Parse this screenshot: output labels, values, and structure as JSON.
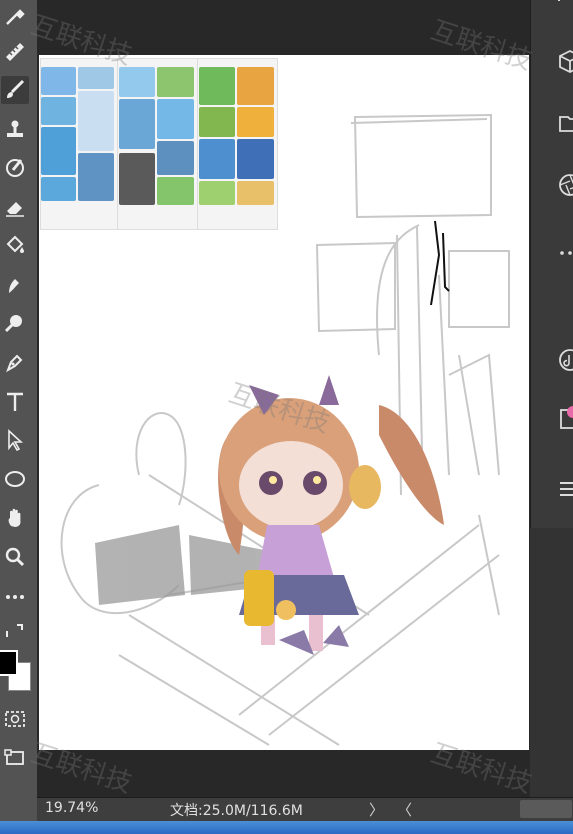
{
  "toolbar": {
    "tools": [
      {
        "name": "eyedropper-icon"
      },
      {
        "name": "ruler-icon"
      },
      {
        "name": "brush-icon"
      },
      {
        "name": "stamp-icon"
      },
      {
        "name": "history-brush-icon"
      },
      {
        "name": "eraser-icon"
      },
      {
        "name": "paint-bucket-icon"
      },
      {
        "name": "smudge-icon"
      },
      {
        "name": "dodge-icon"
      },
      {
        "name": "pen-icon"
      },
      {
        "name": "type-icon"
      },
      {
        "name": "path-select-icon"
      },
      {
        "name": "ellipse-icon"
      },
      {
        "name": "hand-icon"
      },
      {
        "name": "zoom-icon"
      },
      {
        "name": "more-tools-icon"
      }
    ],
    "foreground_color": "#000000",
    "background_color": "#ffffff"
  },
  "status": {
    "zoom": "19.74%",
    "doc_info": "文档:25.0M/116.6M",
    "next_arrow": "〉",
    "prev_arrow": "〈"
  },
  "watermark": "互联科技",
  "colors": {
    "toolbar_bg": "#535353",
    "workspace_bg": "#282828",
    "canvas_bg": "#ffffff",
    "accent_taskbar": "#2b6ac4"
  }
}
